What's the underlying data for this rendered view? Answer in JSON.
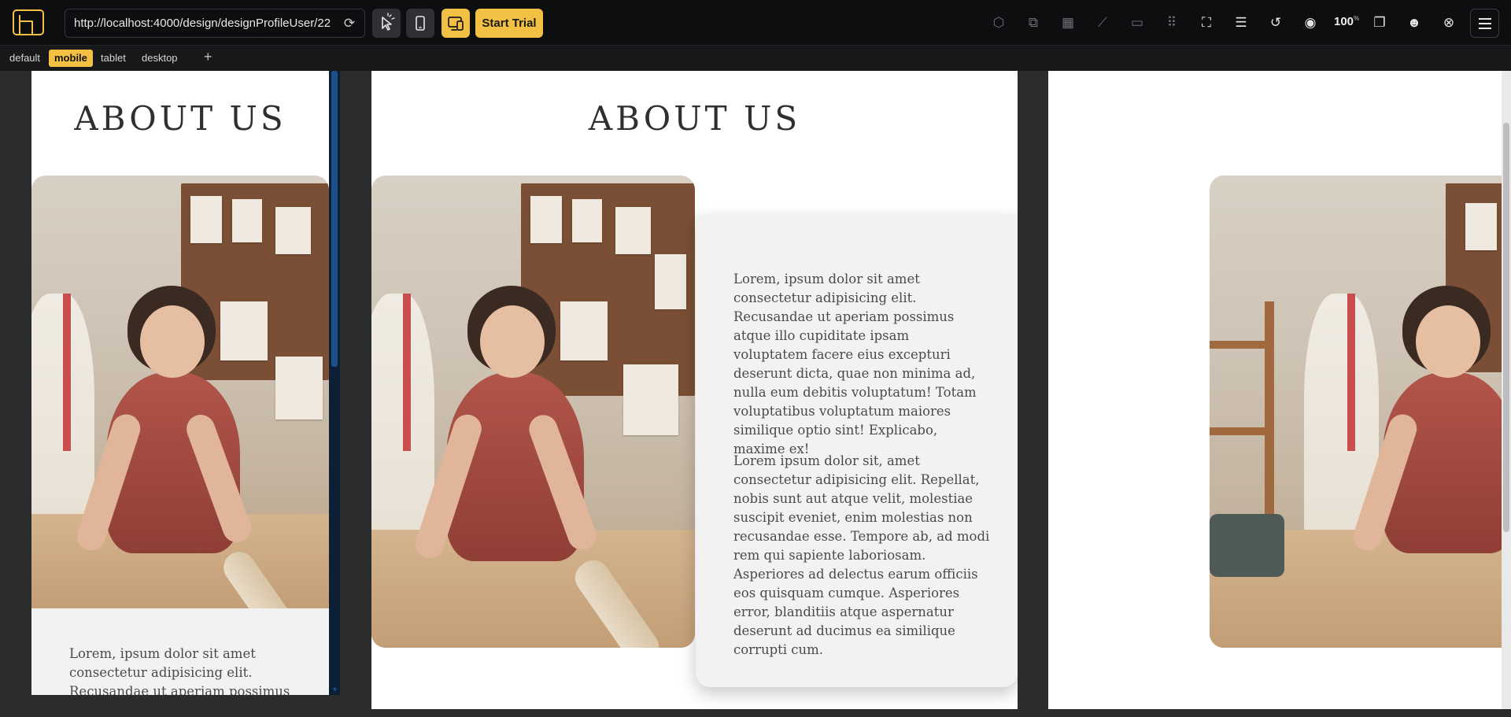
{
  "toolbar": {
    "url": "http://localhost:4000/design/designProfileUser/22",
    "start_trial_label": "Start Trial",
    "zoom_value": "100",
    "zoom_unit": "%",
    "icons": [
      "select-cursor-icon",
      "mobile-device-icon",
      "responsive-devices-icon",
      "cube-icon",
      "overlap-icon",
      "grid-icon",
      "ruler-icon",
      "spacer-icon",
      "dots-grid-icon",
      "focus-frame-icon",
      "stack-icon",
      "undo-icon",
      "camera-icon",
      "layers-icon",
      "discord-icon",
      "close-circle-icon",
      "menu-icon"
    ],
    "colors": {
      "accent": "#f2c043",
      "bar": "#0d0e10"
    }
  },
  "breakpoint_tabs": {
    "items": [
      {
        "label": "default"
      },
      {
        "label": "mobile",
        "active": true
      },
      {
        "label": "tablet"
      },
      {
        "label": "desktop"
      }
    ],
    "add_label": "+"
  },
  "mobile_frame": {
    "heading": "ABOUT US",
    "paragraph_visible": "Lorem, ipsum dolor sit amet consectetur adipisicing elit. Recusandae ut aperiam possimus"
  },
  "tablet_frame": {
    "heading": "ABOUT US",
    "paragraph_1": "Lorem, ipsum dolor sit amet consectetur adipisicing elit. Recusandae ut aperiam possimus atque illo cupiditate ipsam voluptatem facere eius excepturi deserunt dicta, quae non minima ad, nulla eum debitis voluptatum! Totam voluptatibus voluptatum maiores similique optio sint! Explicabo, maxime ex!",
    "paragraph_2": "Lorem ipsum dolor sit, amet consectetur adipisicing elit. Repellat, nobis sunt aut atque velit, molestiae suscipit eveniet, enim molestias non recusandae esse. Tempore ab, ad modi rem qui sapiente laboriosam. Asperiores ad delectus earum officiis eos quisquam cumque. Asperiores error, blanditiis atque aspernatur deserunt ad ducimus ea similique corrupti cum."
  }
}
